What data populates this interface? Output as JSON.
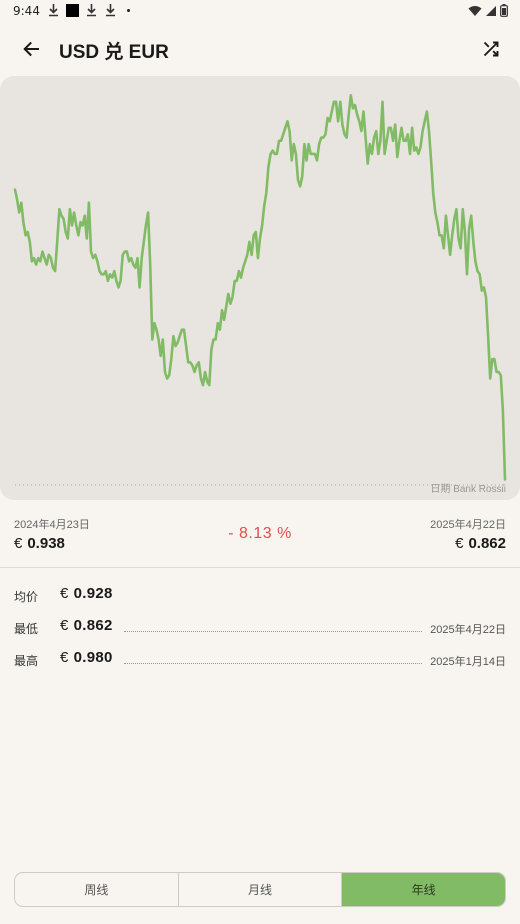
{
  "status": {
    "time": "9:44"
  },
  "header": {
    "title": "USD 兑 EUR",
    "back_icon": "arrow-left-icon",
    "action_icon": "shuffle-icon"
  },
  "chart_data": {
    "type": "line",
    "series": [
      {
        "values": [
          0.951,
          0.948,
          0.944,
          0.947,
          0.941,
          0.937,
          0.938,
          0.935,
          0.929,
          0.93,
          0.928,
          0.93,
          0.929,
          0.932,
          0.93,
          0.928,
          0.931,
          0.93,
          0.927,
          0.926,
          0.935,
          0.945,
          0.943,
          0.942,
          0.938,
          0.936,
          0.945,
          0.94,
          0.944,
          0.94,
          0.937,
          0.941,
          0.94,
          0.943,
          0.936,
          0.947,
          0.932,
          0.93,
          0.931,
          0.929,
          0.926,
          0.925,
          0.925,
          0.926,
          0.923,
          0.925,
          0.924,
          0.926,
          0.923,
          0.921,
          0.923,
          0.931,
          0.932,
          0.932,
          0.929,
          0.93,
          0.928,
          0.927,
          0.93,
          0.921,
          0.93,
          0.935,
          0.94,
          0.944,
          0.928,
          0.905,
          0.91,
          0.908,
          0.905,
          0.9,
          0.905,
          0.895,
          0.893,
          0.894,
          0.899,
          0.906,
          0.903,
          0.904,
          0.906,
          0.908,
          0.908,
          0.903,
          0.898,
          0.898,
          0.897,
          0.895,
          0.897,
          0.898,
          0.893,
          0.891,
          0.895,
          0.892,
          0.891,
          0.902,
          0.905,
          0.905,
          0.91,
          0.908,
          0.914,
          0.911,
          0.915,
          0.919,
          0.916,
          0.918,
          0.923,
          0.923,
          0.926,
          0.924,
          0.927,
          0.929,
          0.931,
          0.935,
          0.931,
          0.937,
          0.938,
          0.93,
          0.936,
          0.94,
          0.946,
          0.95,
          0.958,
          0.962,
          0.963,
          0.962,
          0.962,
          0.966,
          0.966,
          0.968,
          0.97,
          0.972,
          0.969,
          0.96,
          0.965,
          0.962,
          0.954,
          0.952,
          0.955,
          0.965,
          0.96,
          0.965,
          0.962,
          0.962,
          0.962,
          0.96,
          0.965,
          0.967,
          0.967,
          0.968,
          0.973,
          0.972,
          0.975,
          0.978,
          0.978,
          0.972,
          0.978,
          0.971,
          0.968,
          0.967,
          0.974,
          0.98,
          0.976,
          0.977,
          0.974,
          0.972,
          0.969,
          0.975,
          0.967,
          0.959,
          0.965,
          0.962,
          0.967,
          0.969,
          0.962,
          0.966,
          0.978,
          0.962,
          0.966,
          0.97,
          0.97,
          0.966,
          0.971,
          0.961,
          0.966,
          0.97,
          0.966,
          0.966,
          0.968,
          0.962,
          0.97,
          0.963,
          0.964,
          0.962,
          0.964,
          0.969,
          0.972,
          0.975,
          0.969,
          0.96,
          0.95,
          0.944,
          0.941,
          0.937,
          0.937,
          0.933,
          0.943,
          0.937,
          0.931,
          0.937,
          0.942,
          0.945,
          0.936,
          0.933,
          0.945,
          0.938,
          0.925,
          0.939,
          0.943,
          0.935,
          0.929,
          0.926,
          0.925,
          0.92,
          0.921,
          0.918,
          0.906,
          0.893,
          0.899,
          0.899,
          0.895,
          0.895,
          0.894,
          0.883,
          0.862
        ]
      }
    ]
  },
  "chart_source": "日期 Bank Rossii",
  "range": {
    "start_date": "2024年4月23日",
    "start_currency": "€",
    "start_rate": "0.938",
    "change": "- 8.13 %",
    "end_date": "2025年4月22日",
    "end_currency": "€",
    "end_rate": "0.862"
  },
  "stats": {
    "avg_label": "均价",
    "avg_currency": "€",
    "avg_value": "0.928",
    "min_label": "最低",
    "min_currency": "€",
    "min_value": "0.862",
    "min_date": "2025年4月22日",
    "max_label": "最高",
    "max_currency": "€",
    "max_value": "0.980",
    "max_date": "2025年1月14日"
  },
  "tabs": {
    "week": "周线",
    "month": "月线",
    "year": "年线",
    "selected": "year"
  },
  "colors": {
    "line": "#82bb65",
    "negative": "#e0504a",
    "accent": "#82bb65"
  }
}
